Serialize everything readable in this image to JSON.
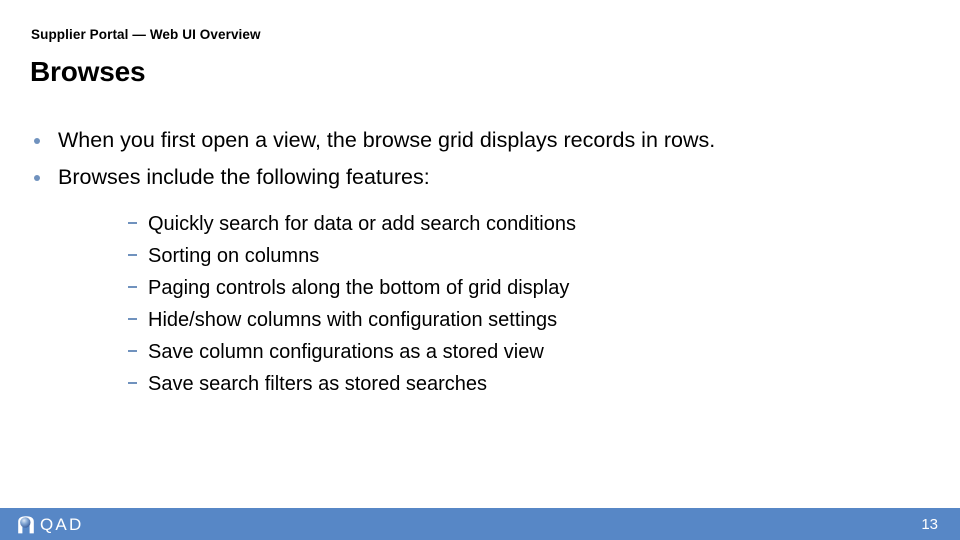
{
  "header": {
    "eyebrow": "Supplier Portal — Web UI Overview",
    "title": "Browses"
  },
  "content": {
    "bullets": [
      {
        "text": "When you first open a view, the browse grid displays records in rows."
      },
      {
        "text": "Browses include the following features:"
      }
    ],
    "sub_bullets": [
      "Quickly search for data or add search conditions",
      "Sorting on columns",
      "Paging controls along the bottom of grid display",
      "Hide/show columns with configuration settings",
      "Save column configurations as a stored view",
      "Save search filters as stored searches"
    ]
  },
  "footer": {
    "logo_text": "QAD",
    "logo_icon": "qad-sphere-logo-icon",
    "page_number": "13",
    "bar_color": "#5787C6",
    "marker_color": "#7092BE"
  }
}
